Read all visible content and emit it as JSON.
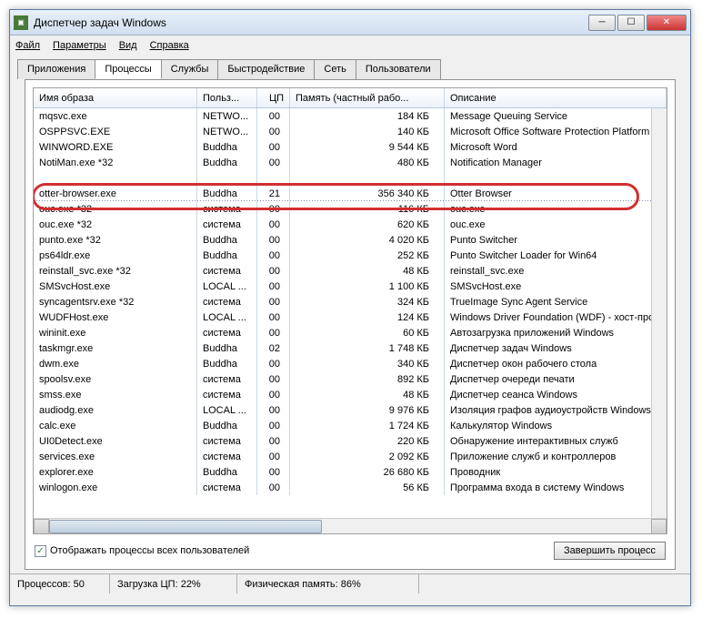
{
  "window": {
    "title": "Диспетчер задач Windows"
  },
  "menu": {
    "file": "Файл",
    "options": "Параметры",
    "view": "Вид",
    "help": "Справка"
  },
  "tabs": {
    "apps": "Приложения",
    "processes": "Процессы",
    "services": "Службы",
    "performance": "Быстродействие",
    "network": "Сеть",
    "users": "Пользователи"
  },
  "columns": {
    "image": "Имя образа",
    "user": "Польз...",
    "cpu": "ЦП",
    "mem": "Память (частный рабо...",
    "desc": "Описание"
  },
  "rows": [
    {
      "img": "mqsvc.exe",
      "user": "NETWO...",
      "cpu": "00",
      "mem": "184 КБ",
      "desc": "Message Queuing Service"
    },
    {
      "img": "OSPPSVC.EXE",
      "user": "NETWO...",
      "cpu": "00",
      "mem": "140 КБ",
      "desc": "Microsoft Office Software Protection Platform S"
    },
    {
      "img": "WINWORD.EXE",
      "user": "Buddha",
      "cpu": "00",
      "mem": "9 544 КБ",
      "desc": "Microsoft Word"
    },
    {
      "img": "NotiMan.exe *32",
      "user": "Buddha",
      "cpu": "00",
      "mem": "480 КБ",
      "desc": "Notification Manager"
    },
    {
      "img": "",
      "user": "",
      "cpu": "",
      "mem": "",
      "desc": ""
    },
    {
      "img": "otter-browser.exe",
      "user": "Buddha",
      "cpu": "21",
      "mem": "356 340 КБ",
      "desc": "Otter Browser"
    },
    {
      "img": "ouc.exe *32",
      "user": "система",
      "cpu": "00",
      "mem": "116 КБ",
      "desc": "ouc.exe"
    },
    {
      "img": "ouc.exe *32",
      "user": "система",
      "cpu": "00",
      "mem": "620 КБ",
      "desc": "ouc.exe"
    },
    {
      "img": "punto.exe *32",
      "user": "Buddha",
      "cpu": "00",
      "mem": "4 020 КБ",
      "desc": "Punto Switcher"
    },
    {
      "img": "ps64ldr.exe",
      "user": "Buddha",
      "cpu": "00",
      "mem": "252 КБ",
      "desc": "Punto Switcher Loader for Win64"
    },
    {
      "img": "reinstall_svc.exe *32",
      "user": "система",
      "cpu": "00",
      "mem": "48 КБ",
      "desc": "reinstall_svc.exe"
    },
    {
      "img": "SMSvcHost.exe",
      "user": "LOCAL ...",
      "cpu": "00",
      "mem": "1 100 КБ",
      "desc": "SMSvcHost.exe"
    },
    {
      "img": "syncagentsrv.exe *32",
      "user": "система",
      "cpu": "00",
      "mem": "324 КБ",
      "desc": "TrueImage Sync Agent Service"
    },
    {
      "img": "WUDFHost.exe",
      "user": "LOCAL ...",
      "cpu": "00",
      "mem": "124 КБ",
      "desc": "Windows Driver Foundation (WDF) - хост-про..."
    },
    {
      "img": "wininit.exe",
      "user": "система",
      "cpu": "00",
      "mem": "60 КБ",
      "desc": "Автозагрузка приложений Windows"
    },
    {
      "img": "taskmgr.exe",
      "user": "Buddha",
      "cpu": "02",
      "mem": "1 748 КБ",
      "desc": "Диспетчер задач Windows"
    },
    {
      "img": "dwm.exe",
      "user": "Buddha",
      "cpu": "00",
      "mem": "340 КБ",
      "desc": "Диспетчер окон рабочего стола"
    },
    {
      "img": "spoolsv.exe",
      "user": "система",
      "cpu": "00",
      "mem": "892 КБ",
      "desc": "Диспетчер очереди печати"
    },
    {
      "img": "smss.exe",
      "user": "система",
      "cpu": "00",
      "mem": "48 КБ",
      "desc": "Диспетчер сеанса  Windows"
    },
    {
      "img": "audiodg.exe",
      "user": "LOCAL ...",
      "cpu": "00",
      "mem": "9 976 КБ",
      "desc": "Изоляция графов аудиоустройств Windows"
    },
    {
      "img": "calc.exe",
      "user": "Buddha",
      "cpu": "00",
      "mem": "1 724 КБ",
      "desc": "Калькулятор Windows"
    },
    {
      "img": "UI0Detect.exe",
      "user": "система",
      "cpu": "00",
      "mem": "220 КБ",
      "desc": "Обнаружение интерактивных служб"
    },
    {
      "img": "services.exe",
      "user": "система",
      "cpu": "00",
      "mem": "2 092 КБ",
      "desc": "Приложение служб и контроллеров"
    },
    {
      "img": "explorer.exe",
      "user": "Buddha",
      "cpu": "00",
      "mem": "26 680 КБ",
      "desc": "Проводник"
    },
    {
      "img": "winlogon.exe",
      "user": "система",
      "cpu": "00",
      "mem": "56 КБ",
      "desc": "Программа входа в систему Windows"
    }
  ],
  "show_all": "Отображать процессы всех пользователей",
  "end_process": "Завершить процесс",
  "status": {
    "procs": "Процессов: 50",
    "cpu": "Загрузка ЦП: 22%",
    "mem": "Физическая память: 86%"
  }
}
